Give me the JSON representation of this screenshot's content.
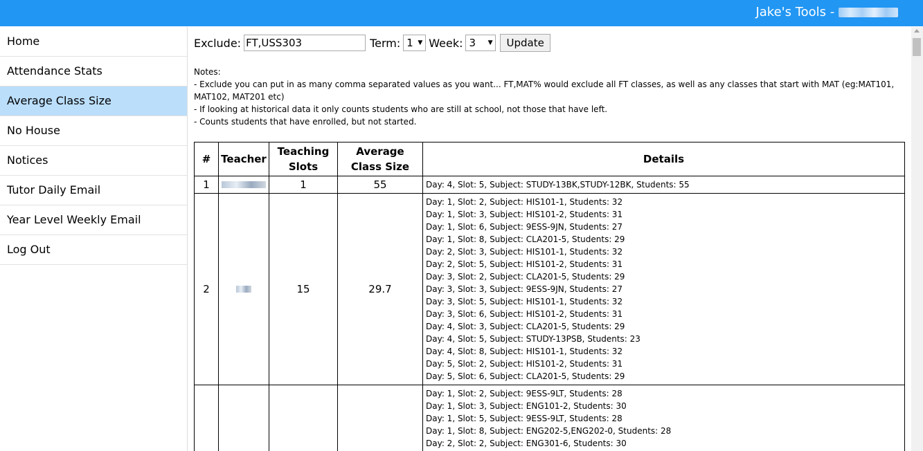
{
  "header": {
    "title": "Jake's Tools -"
  },
  "sidebar": {
    "items": [
      {
        "label": "Home"
      },
      {
        "label": "Attendance Stats"
      },
      {
        "label": "Average Class Size"
      },
      {
        "label": "No House"
      },
      {
        "label": "Notices"
      },
      {
        "label": "Tutor Daily Email"
      },
      {
        "label": "Year Level Weekly Email"
      },
      {
        "label": "Log Out"
      }
    ],
    "active_index": 2
  },
  "form": {
    "exclude_label": "Exclude:",
    "exclude_value": "FT,USS303",
    "term_label": "Term:",
    "term_value": "1",
    "week_label": "Week:",
    "week_value": "3",
    "update_label": "Update"
  },
  "notes": [
    "Notes:",
    "- Exclude you can put in as many comma separated values as you want... FT,MAT% would exclude all FT classes, as well as any classes that start with MAT (eg:MAT101, MAT102, MAT201 etc)",
    "- If looking at historical data it only counts students who are still at school, not those that have left.",
    "- Counts students that have enrolled, but not started."
  ],
  "table": {
    "headers": [
      "#",
      "Teacher",
      "Teaching Slots",
      "Average Class Size",
      "Details"
    ],
    "rows": [
      {
        "num": "1",
        "slots": "1",
        "avg": "55",
        "details": [
          "Day: 4, Slot: 5, Subject: STUDY-13BK,STUDY-12BK, Students: 55"
        ]
      },
      {
        "num": "2",
        "slots": "15",
        "avg": "29.7",
        "details": [
          "Day: 1, Slot: 2, Subject: HIS101-1, Students: 32",
          "Day: 1, Slot: 3, Subject: HIS101-2, Students: 31",
          "Day: 1, Slot: 6, Subject: 9ESS-9JN, Students: 27",
          "Day: 1, Slot: 8, Subject: CLA201-5, Students: 29",
          "Day: 2, Slot: 3, Subject: HIS101-1, Students: 32",
          "Day: 2, Slot: 5, Subject: HIS101-2, Students: 31",
          "Day: 3, Slot: 2, Subject: CLA201-5, Students: 29",
          "Day: 3, Slot: 3, Subject: 9ESS-9JN, Students: 27",
          "Day: 3, Slot: 5, Subject: HIS101-1, Students: 32",
          "Day: 3, Slot: 6, Subject: HIS101-2, Students: 31",
          "Day: 4, Slot: 3, Subject: CLA201-5, Students: 29",
          "Day: 4, Slot: 5, Subject: STUDY-13PSB, Students: 23",
          "Day: 4, Slot: 8, Subject: HIS101-1, Students: 32",
          "Day: 5, Slot: 2, Subject: HIS101-2, Students: 31",
          "Day: 5, Slot: 6, Subject: CLA201-5, Students: 29"
        ]
      },
      {
        "num": "",
        "slots": "",
        "avg": "",
        "details": [
          "Day: 1, Slot: 2, Subject: 9ESS-9LT, Students: 28",
          "Day: 1, Slot: 3, Subject: ENG101-2, Students: 30",
          "Day: 1, Slot: 5, Subject: 9ESS-9LT, Students: 28",
          "Day: 1, Slot: 8, Subject: ENG202-5,ENG202-0, Students: 28",
          "Day: 2, Slot: 2, Subject: ENG301-6, Students: 30"
        ]
      }
    ]
  }
}
